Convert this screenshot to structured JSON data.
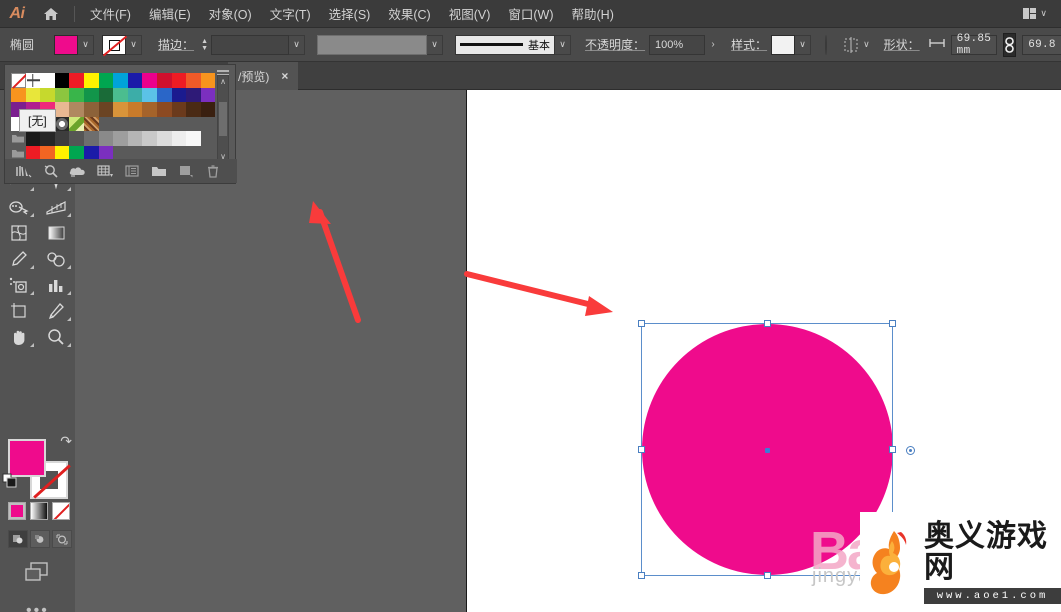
{
  "app": {
    "name": "Ai",
    "home_icon": "home-icon"
  },
  "menubar": {
    "items": [
      {
        "label": "文件(F)"
      },
      {
        "label": "编辑(E)"
      },
      {
        "label": "对象(O)"
      },
      {
        "label": "文字(T)"
      },
      {
        "label": "选择(S)"
      },
      {
        "label": "效果(C)"
      },
      {
        "label": "视图(V)"
      },
      {
        "label": "窗口(W)"
      },
      {
        "label": "帮助(H)"
      }
    ],
    "workspace_caret": "∨"
  },
  "optionsbar": {
    "object_label": "椭圆",
    "fill_color": "#ef0b8c",
    "stroke_swatch": "none",
    "stroke_label": "描边：",
    "stroke_weight_value": "",
    "stroke_field_value": "",
    "profile_label": "基本",
    "opacity_label": "不透明度：",
    "opacity_value": "100%",
    "opacity_arrow": "›",
    "style_label": "样式：",
    "shape_label": "形状：",
    "width_value": "69.85 mm",
    "height_value": "69.8",
    "link_icon": "link-chain-icon",
    "caret": "∨"
  },
  "tabbar": {
    "document_label": "/预览)",
    "close_label": "×"
  },
  "swatches_panel": {
    "tooltip": "[无]",
    "scroll_up": "∧",
    "scroll_down": "∨",
    "footer_icons": [
      "swatch-libraries-icon",
      "color-link-icon",
      "cloud-icon",
      "show-swatch-kinds-icon",
      "swatch-options-icon",
      "new-color-group-icon",
      "new-swatch-icon",
      "delete-swatch-icon"
    ],
    "rows": [
      [
        "none",
        "registration",
        "#ffffff",
        "#000000",
        "#ee1c25",
        "#fff200",
        "#00a650",
        "#00a3d9",
        "#1b1ba8",
        "#ec008c",
        "#cf102d",
        "#ed1c24",
        "#f05a28",
        "#f7941e"
      ],
      [
        "#f7941e",
        "#e8e63a",
        "#c6d92d",
        "#8cc63f",
        "#39b54a",
        "#12954a",
        "#1a6b38",
        "#4bbd8f",
        "#3cada8",
        "#5bc2e7",
        "#2a66c8",
        "#1b1b8f",
        "#2e1a77",
        "#7b2fbf"
      ],
      [
        "#7b1f8f",
        "#b01f8f",
        "#ee2a7b",
        "#e8b892",
        "#b08860",
        "#8c6239",
        "#6b4423",
        "#d9943a",
        "#c97b2a",
        "#a5632a",
        "#8c4a22",
        "#6b3a1c",
        "#4a2a14",
        "#3a2010"
      ],
      [
        "#ffffff",
        "#1a1a1a",
        "#3c2a1a",
        "pattern-circle",
        "pattern-leaf",
        "pattern-texture",
        "",
        "",
        "",
        "",
        "",
        "",
        "",
        ""
      ],
      [
        "folder",
        "#1a1a1a",
        "#262626",
        "#3d3d3d",
        "#555555",
        "#6e6e6e",
        "#8a8a8a",
        "#9e9e9e",
        "#b5b5b5",
        "#c9c9c9",
        "#dcdcdc",
        "#ededed",
        "#f7f7f7",
        ""
      ],
      [
        "folder",
        "#ed1c24",
        "#f26522",
        "#fff200",
        "#00a650",
        "#1b1ba8",
        "#7b2fbf",
        "",
        "",
        "",
        "",
        "",
        "",
        ""
      ]
    ]
  },
  "toolpanel": {
    "tools": [
      {
        "name": "ellipse-tool"
      },
      {
        "name": "paintbrush-tool"
      },
      {
        "name": "pencil-tool"
      },
      {
        "name": "eraser-tool"
      },
      {
        "name": "rotate-tool"
      },
      {
        "name": "scale-tool"
      },
      {
        "name": "width-tool"
      },
      {
        "name": "free-transform-tool"
      },
      {
        "name": "shape-builder-tool"
      },
      {
        "name": "perspective-grid-tool"
      },
      {
        "name": "mesh-tool"
      },
      {
        "name": "gradient-tool"
      },
      {
        "name": "eyedropper-tool"
      },
      {
        "name": "blend-tool"
      },
      {
        "name": "symbol-sprayer-tool"
      },
      {
        "name": "column-graph-tool"
      },
      {
        "name": "artboard-tool"
      },
      {
        "name": "slice-tool"
      },
      {
        "name": "hand-tool"
      },
      {
        "name": "zoom-tool"
      }
    ],
    "fill_color": "#ef0b8c",
    "stroke_color": "none",
    "swap_icon": "swap-fill-stroke-icon",
    "fill_modes": [
      "color-fill",
      "gradient-fill",
      "none-fill"
    ],
    "draw_modes": [
      "draw-normal",
      "draw-behind",
      "draw-inside"
    ],
    "screen_mode": "change-screen-mode-icon",
    "more_tools": "•••"
  },
  "canvas": {
    "shape": {
      "type": "ellipse",
      "fill": "#ef0b8c",
      "selected": true,
      "selection_color": "#5b8ecb"
    },
    "annotations": [
      {
        "name": "red-arrow-up-left",
        "color": "#f93b3b"
      },
      {
        "name": "red-arrow-down-right",
        "color": "#f93b3b"
      }
    ]
  },
  "watermarks": {
    "baidu_text": "Ba",
    "baidu_sub": "jingyan",
    "site_name": "奥义游戏网",
    "site_url": "www.aoe1.com",
    "logo_icon": "phoenix-logo-icon"
  }
}
